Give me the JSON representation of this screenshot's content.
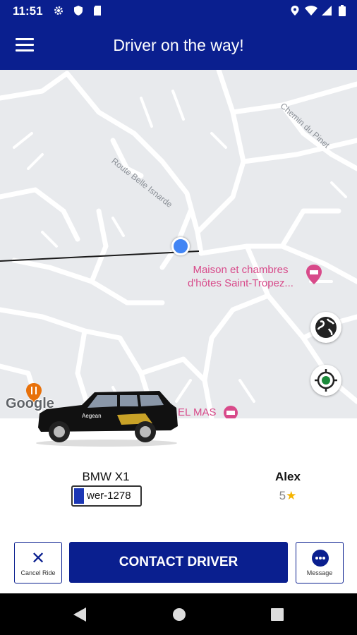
{
  "status_bar": {
    "time": "11:51",
    "left_icons": [
      "gear-icon",
      "shield-icon",
      "sd-card-icon"
    ],
    "right_icons": [
      "location-icon",
      "wifi-icon",
      "signal-icon",
      "battery-icon"
    ]
  },
  "app_bar": {
    "title": "Driver on the way!",
    "menu_icon": "hamburger-menu-icon"
  },
  "map": {
    "road_labels": [
      "Route Belle Isnarde",
      "Chemin du Pinet"
    ],
    "poi_name": "Maison et chambres d'hôtes Saint-Tropez...",
    "poi_label_partial": "EL MAS",
    "attribution": "Google",
    "buttons": [
      "globe-icon",
      "my-location-icon"
    ]
  },
  "ride": {
    "vehicle_name": "BMW X1",
    "plate_number": "wer-1278",
    "driver_name": "Alex",
    "driver_rating": "5"
  },
  "actions": {
    "cancel_label": "Cancel Ride",
    "contact_label": "CONTACT DRIVER",
    "message_label": "Message"
  },
  "colors": {
    "brand": "#0a1f8f",
    "map_background": "#e8eaed",
    "poi": "#d84a8a",
    "location_dot": "#4285f4",
    "star": "#f5b400"
  }
}
